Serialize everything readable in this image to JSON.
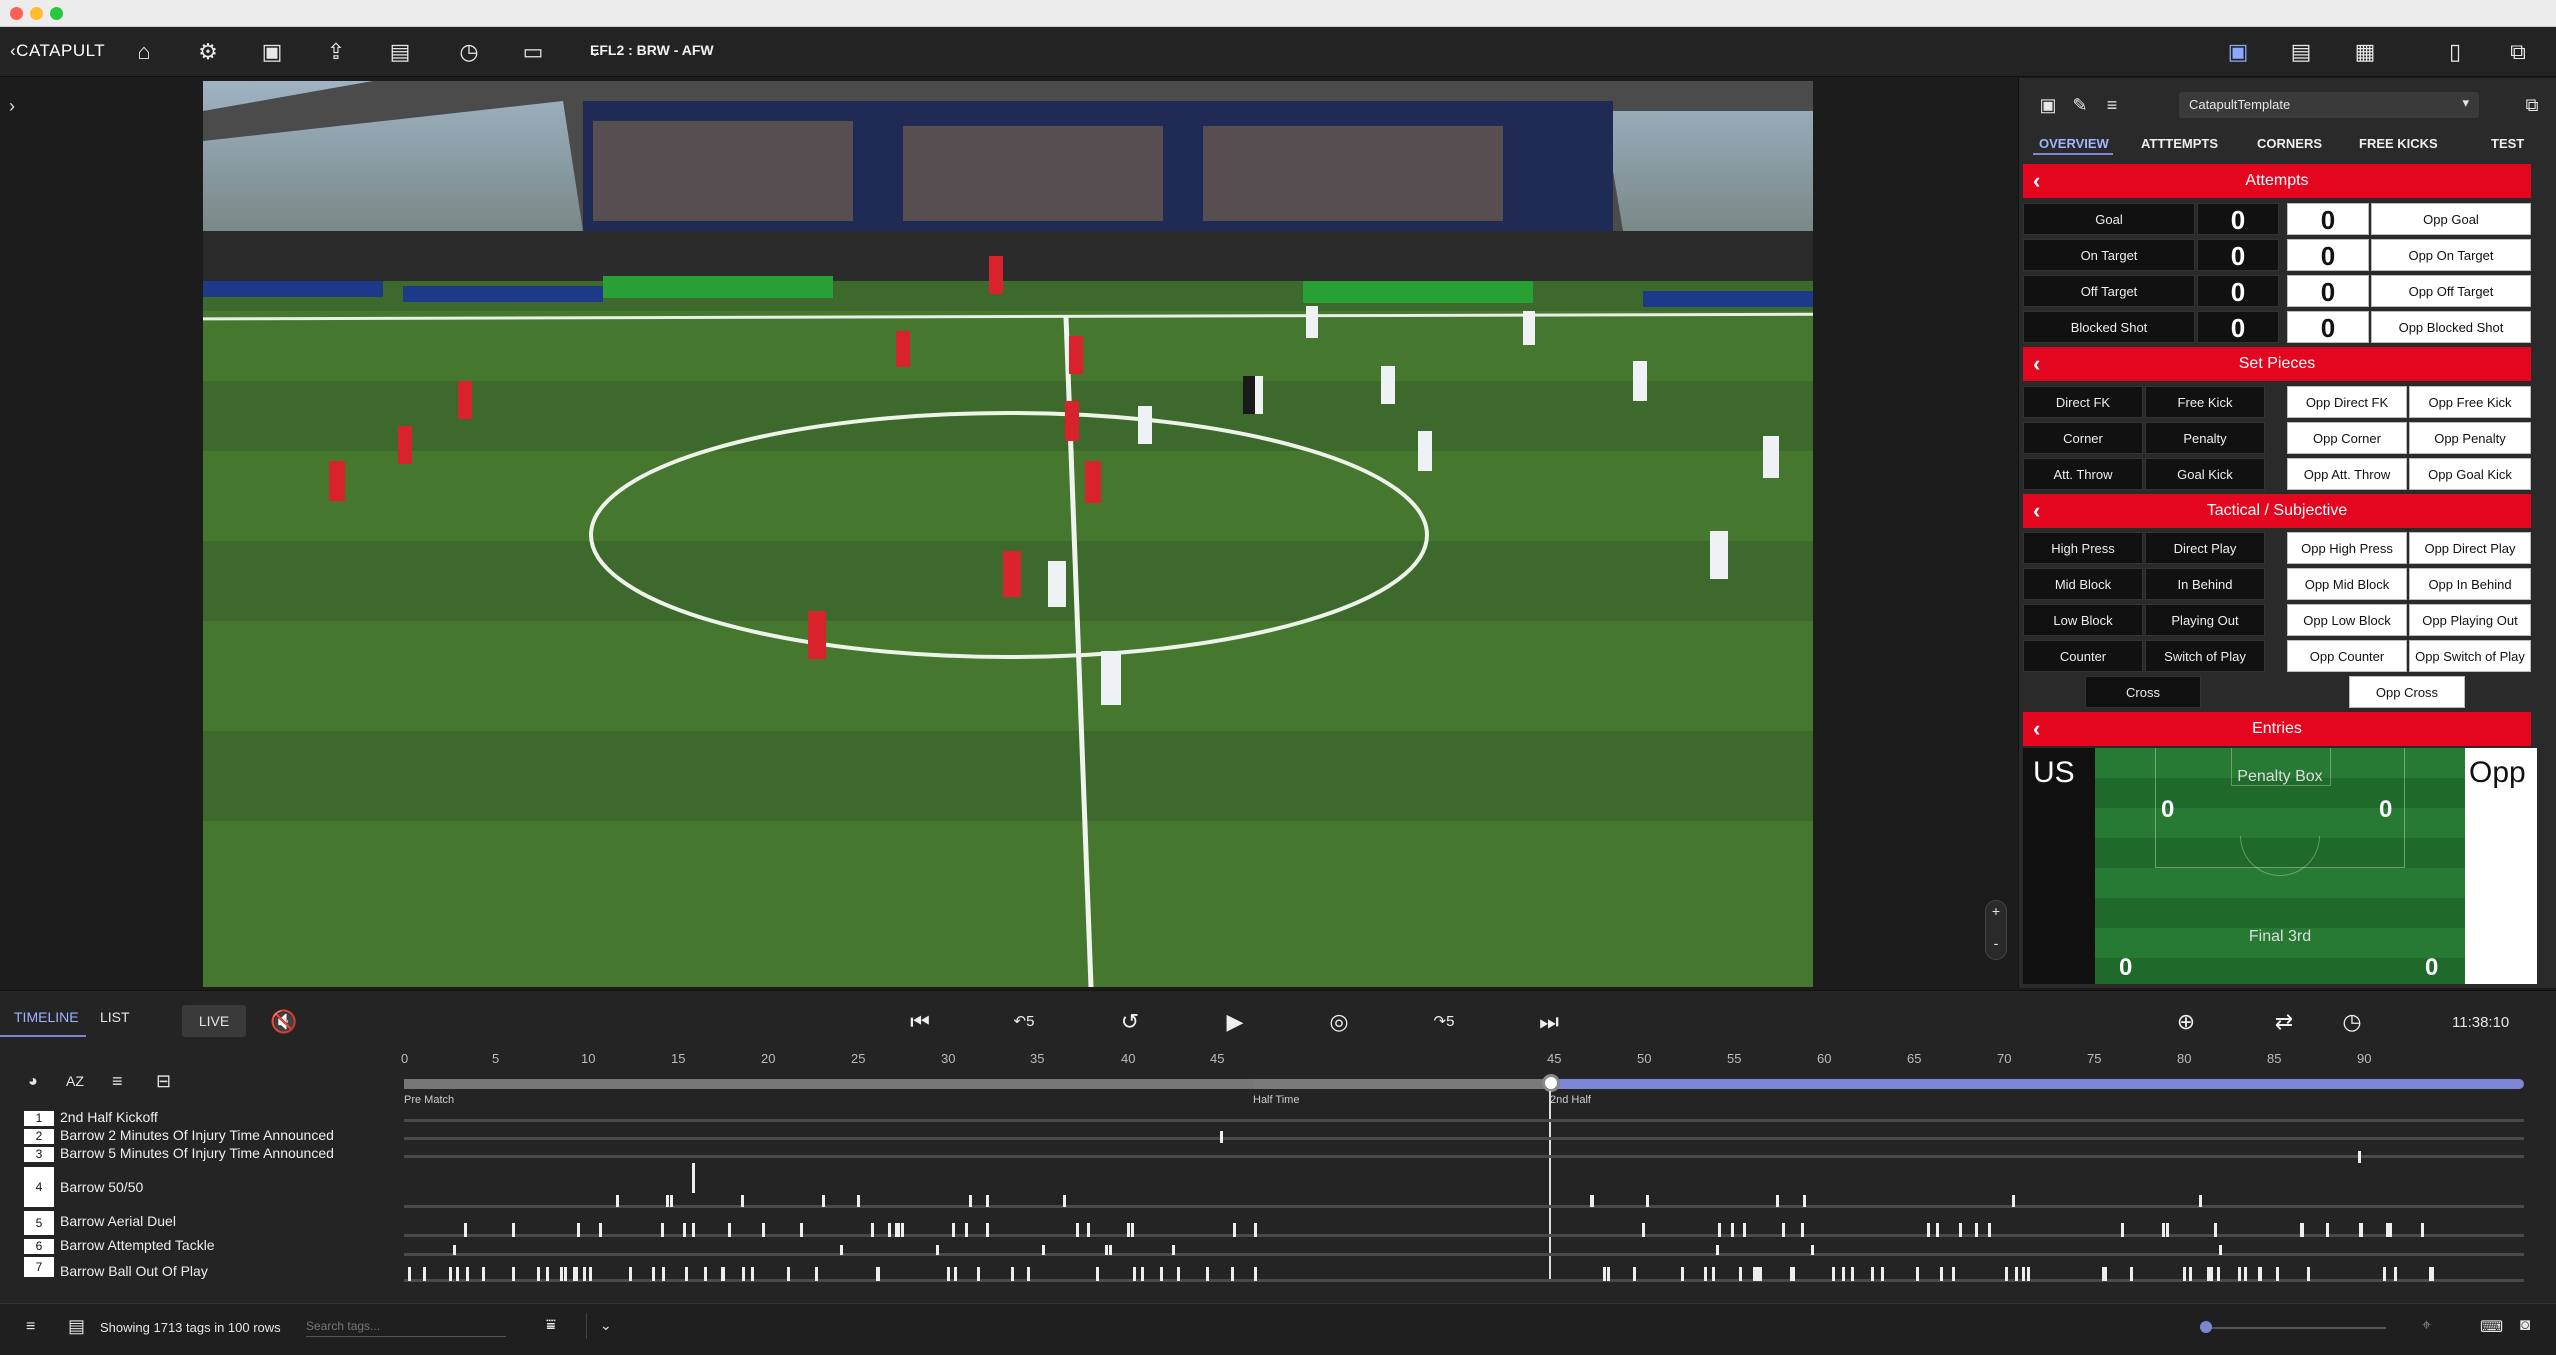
{
  "topbar": {
    "logo": "CATAPULT",
    "match_title": "EFL2 : BRW - AFW",
    "icons": [
      "home-icon",
      "settings-icon",
      "camera-icon",
      "export-icon",
      "bookmark-icon",
      "clock-icon",
      "monitor-icon"
    ]
  },
  "panel": {
    "template": "CatapultTemplate",
    "tabs": [
      "OVERVIEW",
      "ATTTEMPTS",
      "CORNERS",
      "FREE KICKS",
      "TEST"
    ],
    "attempts": {
      "title": "Attempts",
      "rows": [
        {
          "us": "Goal",
          "us_val": "0",
          "opp_val": "0",
          "opp": "Opp Goal"
        },
        {
          "us": "On Target",
          "us_val": "0",
          "opp_val": "0",
          "opp": "Opp On Target"
        },
        {
          "us": "Off Target",
          "us_val": "0",
          "opp_val": "0",
          "opp": "Opp Off Target"
        },
        {
          "us": "Blocked Shot",
          "us_val": "0",
          "opp_val": "0",
          "opp": "Opp Blocked Shot"
        }
      ]
    },
    "set_pieces": {
      "title": "Set Pieces",
      "us": [
        [
          "Direct FK",
          "Free Kick"
        ],
        [
          "Corner",
          "Penalty"
        ],
        [
          "Att. Throw",
          "Goal Kick"
        ]
      ],
      "opp": [
        [
          "Opp Direct FK",
          "Opp Free Kick"
        ],
        [
          "Opp Corner",
          "Opp Penalty"
        ],
        [
          "Opp Att. Throw",
          "Opp Goal Kick"
        ]
      ]
    },
    "tactical": {
      "title": "Tactical / Subjective",
      "us": [
        [
          "High Press",
          "Direct Play"
        ],
        [
          "Mid Block",
          "In Behind"
        ],
        [
          "Low Block",
          "Playing Out"
        ],
        [
          "Counter",
          "Switch of Play"
        ]
      ],
      "opp": [
        [
          "Opp High Press",
          "Opp Direct Play"
        ],
        [
          "Opp Mid Block",
          "Opp In Behind"
        ],
        [
          "Opp Low Block",
          "Opp Playing Out"
        ],
        [
          "Opp Counter",
          "Opp Switch of Play"
        ]
      ],
      "cross": "Cross",
      "opp_cross": "Opp Cross"
    },
    "entries": {
      "title": "Entries",
      "us": "US",
      "opp": "Opp",
      "penalty_box": "Penalty Box",
      "final_third": "Final 3rd",
      "pb_left": "0",
      "pb_right": "0",
      "f3_left": "0",
      "f3_right": "0"
    }
  },
  "bottom": {
    "tab_timeline": "TIMELINE",
    "tab_list": "LIST",
    "live": "LIVE",
    "step_back": "5",
    "step_fwd": "5",
    "time": "11:38:10",
    "ticks": [
      "0",
      "5",
      "10",
      "15",
      "20",
      "25",
      "30",
      "35",
      "40",
      "45",
      "45",
      "50",
      "55",
      "60",
      "65",
      "70",
      "75",
      "80",
      "85",
      "90"
    ],
    "periods": [
      "Pre Match",
      "Half Time",
      "2nd Half"
    ],
    "rows": [
      {
        "num": "1",
        "name": "2nd Half Kickoff"
      },
      {
        "num": "2",
        "name": "Barrow 2 Minutes Of Injury Time Announced"
      },
      {
        "num": "3",
        "name": "Barrow 5 Minutes Of Injury Time Announced"
      },
      {
        "num": "4",
        "name": "Barrow 50/50"
      },
      {
        "num": "5",
        "name": "Barrow Aerial Duel"
      },
      {
        "num": "6",
        "name": "Barrow Attempted Tackle"
      },
      {
        "num": "7",
        "name": "Barrow Ball Out Of Play"
      }
    ],
    "status": "Showing 1713 tags in 100 rows",
    "search_placeholder": "Search tags..."
  },
  "colors": {
    "accent": "#e4051f",
    "timeline_blue": "#7d86d6",
    "timeline_green": "#2f7d32"
  }
}
